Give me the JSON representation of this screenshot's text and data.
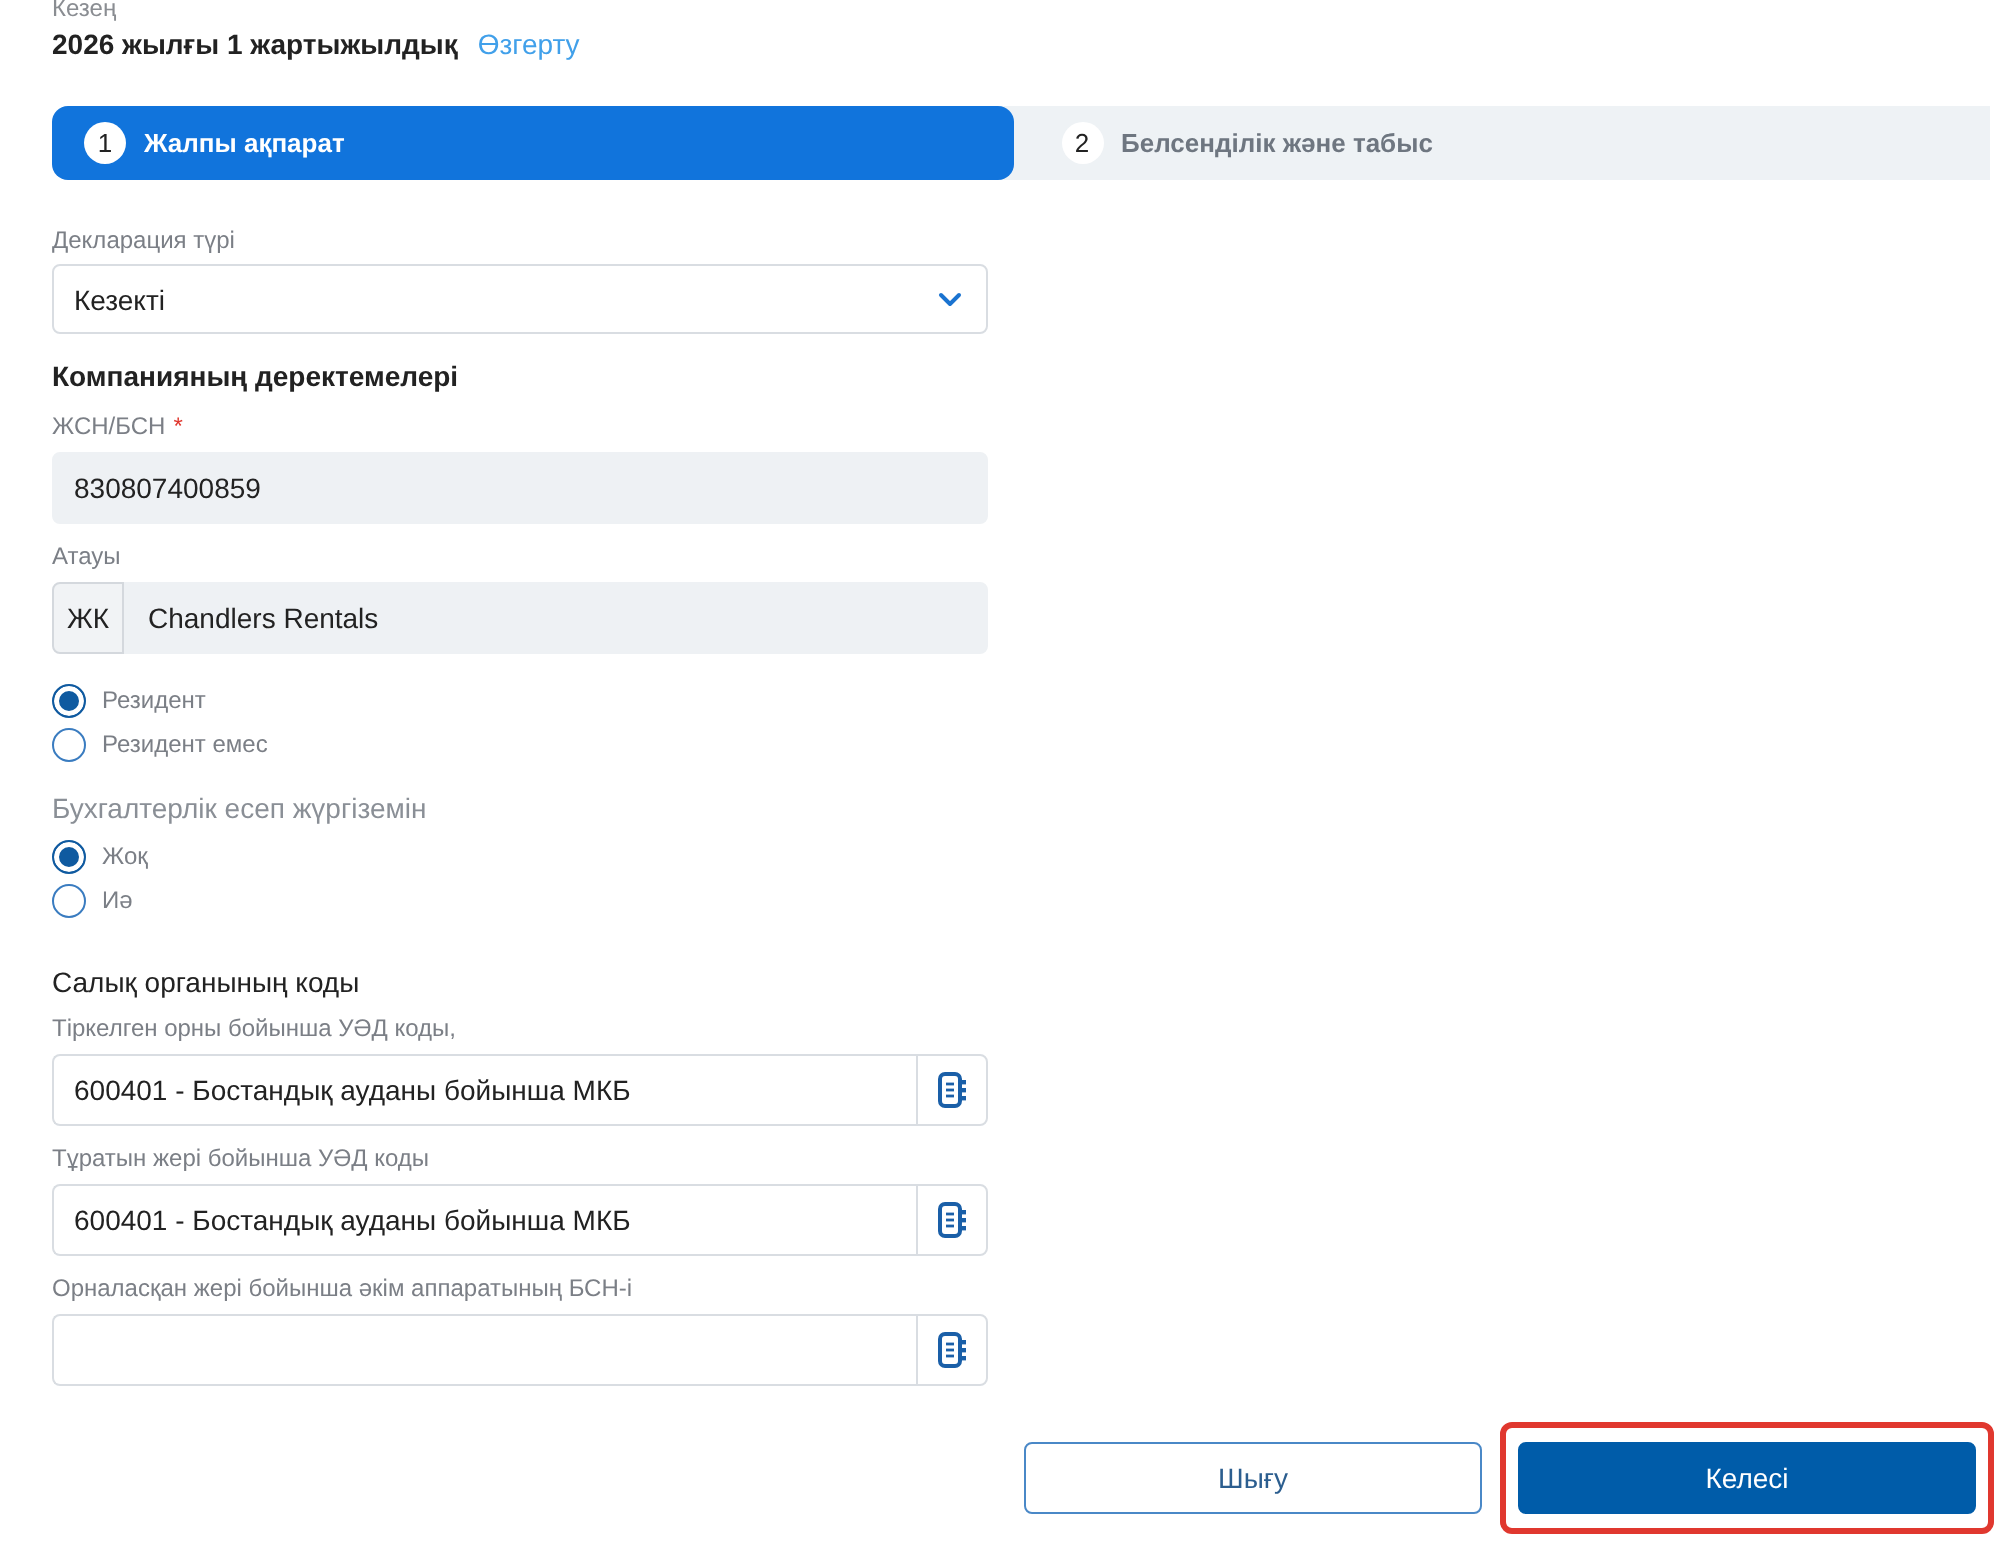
{
  "period": {
    "label": "Кезең",
    "value": "2026 жылғы 1 жартыжылдық",
    "change_link": "Өзгерту"
  },
  "steps": [
    {
      "number": "1",
      "label": "Жалпы ақпарат",
      "selected": true
    },
    {
      "number": "2",
      "label": "Белсенділік және табыс",
      "selected": false
    }
  ],
  "declaration_type": {
    "label": "Декларация түрі",
    "value": "Кезекті"
  },
  "company_section": {
    "title": "Компанияның деректемелері",
    "fields": [
      {
        "label": "ЖСН/БСН",
        "required_mark": "*",
        "value": "830807400859",
        "disabled": true
      },
      {
        "label": "Атауы",
        "prefix": "ЖК",
        "value": "Chandlers Rentals",
        "disabled": true
      }
    ]
  },
  "residency": [
    {
      "label": "Резидент",
      "selected": true
    },
    {
      "label": "Резидент емес",
      "selected": false
    }
  ],
  "accounting": {
    "label": "Бухгалтерлік есеп жүргіземін",
    "options": [
      {
        "label": "Жоқ",
        "selected": true
      },
      {
        "label": "Иә",
        "selected": false
      }
    ]
  },
  "tax_office": {
    "title": "Салық органының коды",
    "fields": [
      {
        "label": "Тіркелген орны бойынша УӘД коды,",
        "value": "600401 - Бостандық ауданы бойынша МКБ",
        "disabled": false
      },
      {
        "label": "Тұратын жері бойынша УӘД коды",
        "value": "600401 - Бостандық ауданы бойынша МКБ",
        "disabled": false
      },
      {
        "label": "Орналасқан жері бойынша әкім аппаратының БСН-і",
        "disabled": false
      }
    ]
  },
  "buttons": [
    {
      "label": "Шығу",
      "kind": "secondary",
      "highlighted": false
    },
    {
      "label": "Келесі",
      "kind": "primary",
      "highlighted": true
    }
  ]
}
